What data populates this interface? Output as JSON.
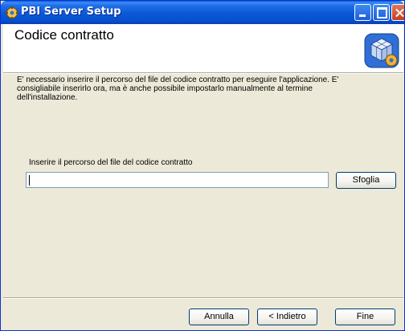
{
  "window": {
    "title": "PBI Server Setup",
    "title_icon": "gear-setup-icon",
    "controls": [
      "minimize",
      "maximize",
      "close"
    ]
  },
  "header": {
    "title": "Codice contratto",
    "logo": "setup-package-icon"
  },
  "description": {
    "line1": "E' necessario inserire il percorso del file del codice contratto per eseguire l'applicazione. E'",
    "line2": "consigliabile inserirlo ora, ma è anche possibile impostarlo manualmente al termine",
    "line3": "dell'installazione."
  },
  "contract_path": {
    "label": "Inserire il percorso del file del codice contratto",
    "value": "",
    "browse_label": "Sfoglia"
  },
  "footer": {
    "cancel_label": "Annulla",
    "back_label": "< Indietro",
    "finish_label": "Fine"
  }
}
